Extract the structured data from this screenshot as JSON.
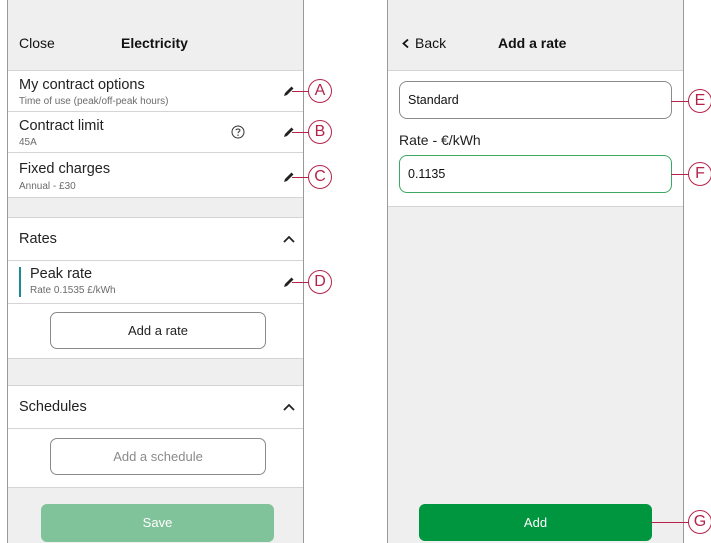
{
  "colors": {
    "accent_green": "#00953f",
    "save_disabled": "#80c29a",
    "rate_marker": "#1a8a9a",
    "callout": "#b4234a"
  },
  "left_screen": {
    "header": {
      "close_label": "Close",
      "title": "Electricity"
    },
    "settings": [
      {
        "title": "My contract options",
        "subtitle": "Time of use (peak/off-peak hours)",
        "icon": "pencil-icon",
        "callout": "A"
      },
      {
        "title": "Contract limit",
        "subtitle": "45A",
        "icon": "pencil-icon",
        "help_icon": "help-circle-icon",
        "callout": "B"
      },
      {
        "title": "Fixed charges",
        "subtitle": "Annual - £30",
        "icon": "pencil-icon",
        "callout": "C"
      }
    ],
    "rates_section": {
      "title": "Rates",
      "expand_icon": "chevron-up-icon",
      "items": [
        {
          "title": "Peak rate",
          "subtitle": "Rate 0.1535 £/kWh",
          "icon": "pencil-icon",
          "callout": "D"
        }
      ],
      "add_button": "Add a rate"
    },
    "schedules_section": {
      "title": "Schedules",
      "expand_icon": "chevron-up-icon",
      "add_button": "Add a schedule"
    },
    "save_button": "Save"
  },
  "right_screen": {
    "header": {
      "back_label": "Back",
      "back_icon": "chevron-left-icon",
      "title": "Add a rate"
    },
    "name_field": {
      "value": "Standard",
      "callout": "E"
    },
    "rate_label": "Rate - €/kWh",
    "rate_field": {
      "value": "0.1135",
      "callout": "F"
    },
    "add_button": {
      "label": "Add",
      "callout": "G"
    }
  }
}
